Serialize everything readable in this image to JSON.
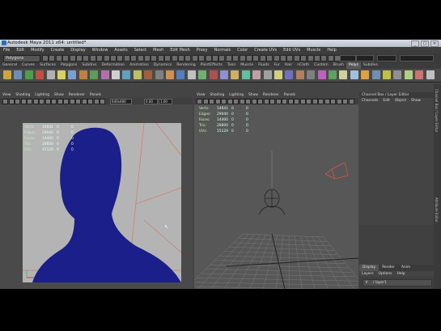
{
  "window": {
    "title": "Autodesk Maya 2011 x64: untitled*"
  },
  "menubar": {
    "items": [
      "File",
      "Edit",
      "Modify",
      "Create",
      "Display",
      "Window",
      "Assets",
      "Select",
      "Mesh",
      "Edit Mesh",
      "Proxy",
      "Normals",
      "Color",
      "Create UVs",
      "Edit UVs",
      "Muscle",
      "Help"
    ]
  },
  "statusline": {
    "mode": "Polygons"
  },
  "shelf": {
    "tabs": [
      "General",
      "Curves",
      "Surfaces",
      "Polygons",
      "Subdivs",
      "Deformation",
      "Animation",
      "Dynamics",
      "Rendering",
      "PaintEffects",
      "Toon",
      "Muscle",
      "Fluids",
      "Fur",
      "Hair",
      "nCloth",
      "Custom",
      "Brush",
      "Polys",
      "Subdivs"
    ],
    "active_tab": "Polys",
    "icon_colors": [
      "#c9a640",
      "#6d8fb5",
      "#4aa04a",
      "#c05040",
      "#b0b0b0",
      "#d8d060",
      "#7aa0d0",
      "#c08040",
      "#5c9c5c",
      "#b070b0",
      "#d0d0d0",
      "#60a0c0",
      "#c0c060",
      "#a06040",
      "#808080",
      "#d09050",
      "#5080c0",
      "#c0c0c0",
      "#70b070",
      "#b05050",
      "#9090d0",
      "#d0b060",
      "#60c0a0",
      "#c0a0a0",
      "#a0a0a0",
      "#d0d080",
      "#7070c0",
      "#b08060",
      "#808080",
      "#c060c0",
      "#60a060",
      "#d0d0a0",
      "#a0c0e0",
      "#e0a040",
      "#7090b0",
      "#c0c040",
      "#909090",
      "#b0d080",
      "#d07070",
      "#c0c0c0"
    ]
  },
  "left_viewport": {
    "menu": [
      "View",
      "Shading",
      "Lighting",
      "Show",
      "Renderer",
      "Panels"
    ],
    "resolution": "640x480",
    "field1": "0.00",
    "field2": "1.00",
    "hud": [
      {
        "label": "Verts:",
        "a": "14641",
        "b": "0",
        "c": "0"
      },
      {
        "label": "Edges:",
        "a": "29040",
        "b": "0",
        "c": "0"
      },
      {
        "label": "Faces:",
        "a": "14400",
        "b": "0",
        "c": "0"
      },
      {
        "label": "Tris:",
        "a": "28800",
        "b": "0",
        "c": "0"
      },
      {
        "label": "UVs:",
        "a": "15129",
        "b": "0",
        "c": "0"
      }
    ],
    "background": "#b4b4b4",
    "silhouette": "#1a1f8a"
  },
  "right_viewport": {
    "menu": [
      "View",
      "Shading",
      "Lighting",
      "Show",
      "Renderer",
      "Panels"
    ],
    "hud": [
      {
        "label": "Verts:",
        "a": "14641",
        "b": "0",
        "c": "0"
      },
      {
        "label": "Edges:",
        "a": "29040",
        "b": "0",
        "c": "0"
      },
      {
        "label": "Faces:",
        "a": "14400",
        "b": "0",
        "c": "0"
      },
      {
        "label": "Tris:",
        "a": "28800",
        "b": "0",
        "c": "0"
      },
      {
        "label": "UVs:",
        "a": "15129",
        "b": "0",
        "c": "0"
      }
    ],
    "background": "#575757"
  },
  "channelbox": {
    "title": "Channel Box / Layer Editor",
    "menu": [
      "Channels",
      "Edit",
      "Object",
      "Show"
    ]
  },
  "layer_editor": {
    "tabs": [
      "Display",
      "Render",
      "Anim"
    ],
    "menu": [
      "Layers",
      "Options",
      "Help"
    ],
    "layer_v": "V",
    "layer_name": "/ layer1"
  },
  "side_tabs": [
    "Channel Box / Layer Editor",
    "Attribute Editor"
  ],
  "accent": "#d8b33a"
}
